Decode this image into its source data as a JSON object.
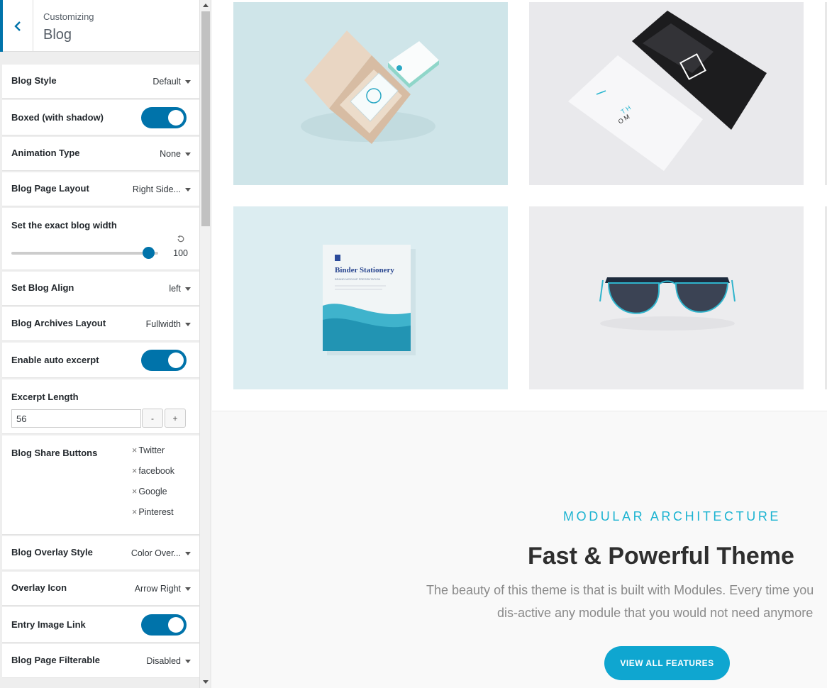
{
  "header": {
    "breadcrumb": "Customizing",
    "section_title": "Blog"
  },
  "controls": {
    "blog_style": {
      "label": "Blog Style",
      "value": "Default"
    },
    "boxed": {
      "label": "Boxed (with shadow)",
      "enabled": true
    },
    "animation_type": {
      "label": "Animation Type",
      "value": "None"
    },
    "page_layout": {
      "label": "Blog Page Layout",
      "value": "Right Side..."
    },
    "blog_width": {
      "label": "Set the exact blog width",
      "value": "100",
      "level": 100
    },
    "blog_align": {
      "label": "Set Blog Align",
      "value": "left"
    },
    "archives_layout": {
      "label": "Blog Archives Layout",
      "value": "Fullwidth"
    },
    "auto_excerpt": {
      "label": "Enable auto excerpt",
      "enabled": true
    },
    "excerpt_length": {
      "label": "Excerpt Length",
      "value": "56",
      "minus": "-",
      "plus": "+"
    },
    "share_buttons": {
      "label": "Blog Share Buttons",
      "remove_glyph": "×",
      "items": [
        "Twitter",
        "facebook",
        "Google",
        "Pinterest"
      ]
    },
    "overlay_style": {
      "label": "Blog Overlay Style",
      "value": "Color Over..."
    },
    "overlay_icon": {
      "label": "Overlay Icon",
      "value": "Arrow Right"
    },
    "entry_image_link": {
      "label": "Entry Image Link",
      "enabled": true
    },
    "page_filterable": {
      "label": "Blog Page Filterable",
      "value": "Disabled"
    }
  },
  "preview": {
    "tiles": {
      "stationery_text": "Binder Stationery",
      "stationery_sub": "BRAND MOCKUP PRESENTATION"
    },
    "feature": {
      "eyebrow": "MODULAR ARCHITECTURE",
      "headline": "Fast & Powerful Theme",
      "desc_line1": "The beauty of this theme is that is built with Modules. Every time you",
      "desc_line2": "dis-active any module that you would not need anymore",
      "cta_label": "VIEW ALL FEATURES"
    }
  },
  "colors": {
    "accent": "#0073aa",
    "brand": "#0fa6d0",
    "eyebrow": "#1bb3d1"
  },
  "icons": {
    "back": "chevron-left-icon",
    "reset": "reset-icon",
    "dropdown": "caret-down-icon"
  }
}
